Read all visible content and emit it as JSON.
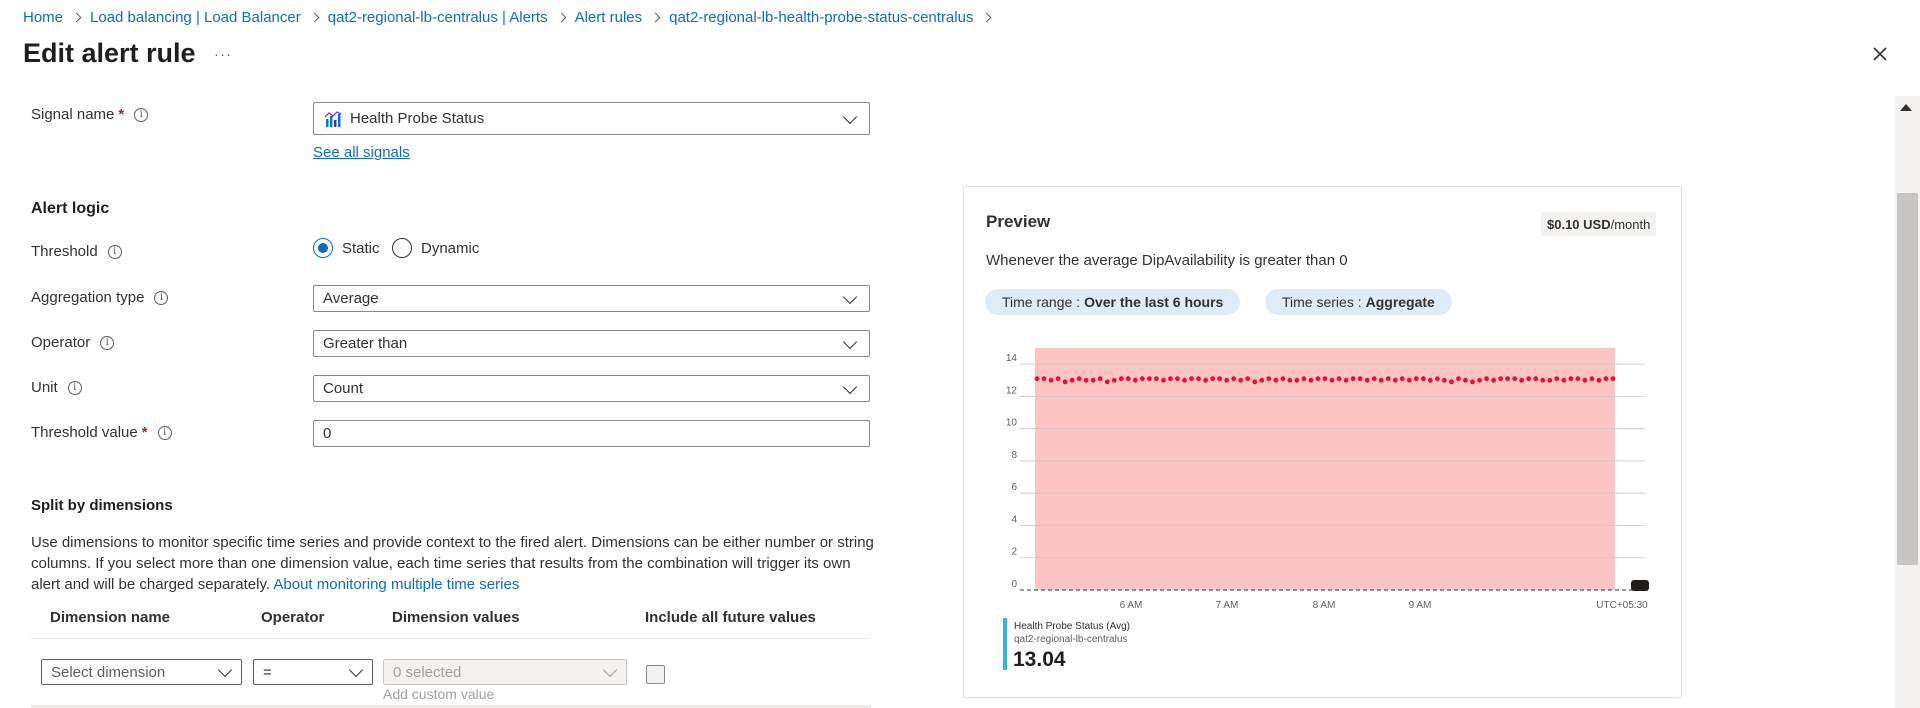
{
  "breadcrumb": {
    "items": [
      "Home",
      "Load balancing | Load Balancer",
      "qat2-regional-lb-centralus | Alerts",
      "Alert rules",
      "qat2-regional-lb-health-probe-status-centralus"
    ]
  },
  "header": {
    "title": "Edit alert rule",
    "more": "···"
  },
  "form": {
    "signal_name_label": "Signal name",
    "signal_name_value": "Health Probe Status",
    "see_all_signals": "See all signals",
    "alert_logic_heading": "Alert logic",
    "threshold_label": "Threshold",
    "threshold_static": "Static",
    "threshold_dynamic": "Dynamic",
    "threshold_selected": "Static",
    "aggregation_label": "Aggregation type",
    "aggregation_value": "Average",
    "operator_label": "Operator",
    "operator_value": "Greater than",
    "unit_label": "Unit",
    "unit_value": "Count",
    "threshold_value_label": "Threshold value",
    "threshold_value": "0"
  },
  "split": {
    "heading": "Split by dimensions",
    "description": "Use dimensions to monitor specific time series and provide context to the fired alert. Dimensions can be either number or string columns. If you select more than one dimension value, each time series that results from the combination will trigger its own alert and will be charged separately. ",
    "about_link": "About monitoring multiple time series",
    "columns": [
      "Dimension name",
      "Operator",
      "Dimension values",
      "Include all future values"
    ],
    "row": {
      "dimension_placeholder": "Select dimension",
      "operator": "=",
      "values": "0 selected",
      "add_custom": "Add custom value"
    }
  },
  "preview": {
    "title": "Preview",
    "cost_amount": "$0.10 USD",
    "cost_unit": "/month",
    "sentence": "Whenever the average DipAvailability is greater than 0",
    "time_range_label": "Time range :",
    "time_range_value": "Over the last 6 hours",
    "time_series_label": "Time series :",
    "time_series_value": "Aggregate",
    "legend_name": "Health Probe Status (Avg)",
    "legend_resource": "qat2-regional-lb-centralus",
    "legend_value": "13.04"
  },
  "colors": {
    "accent": "#0f6cbd",
    "alert_region": "#fdc4c4",
    "series_point": "#e8112d",
    "legend_bar": "#3bb0e0"
  },
  "chart_data": {
    "type": "scatter",
    "y_ticks": [
      "0",
      "2",
      "4",
      "6",
      "8",
      "10",
      "12",
      "14"
    ],
    "x_ticks": [
      "6 AM",
      "7 AM",
      "8 AM",
      "9 AM",
      "UTC+05:30"
    ],
    "ylim": [
      0,
      15
    ],
    "threshold": 0,
    "grid": true,
    "series": [
      {
        "name": "Health Probe Status (Avg)",
        "values": [
          13.1,
          13.1,
          13.0,
          13.1,
          12.9,
          13.0,
          13.1,
          13.0,
          13.0,
          13.1,
          12.9,
          13.0,
          13.1,
          13.1,
          13.0,
          13.1,
          13.1,
          13.1,
          13.0,
          13.1,
          13.1,
          13.0,
          13.1,
          13.1,
          13.0,
          13.1,
          13.1,
          13.0,
          13.1,
          13.0,
          13.1,
          12.9,
          13.0,
          13.1,
          13.0,
          13.1,
          13.0,
          13.0,
          13.1,
          13.0,
          13.1,
          13.1,
          13.0,
          13.1,
          13.0,
          13.1,
          13.1,
          13.0,
          13.1,
          13.0,
          13.1,
          13.0,
          13.1,
          13.0,
          13.1,
          13.1,
          13.0,
          13.1,
          13.0,
          12.9,
          13.1,
          13.0,
          12.9,
          13.0,
          13.1,
          13.0,
          13.1,
          13.1,
          13.1,
          13.0,
          13.1,
          13.1,
          13.0,
          13.0,
          13.1,
          13.0,
          13.1,
          13.1,
          13.0,
          13.1,
          13.0,
          13.1,
          13.1
        ]
      }
    ]
  }
}
